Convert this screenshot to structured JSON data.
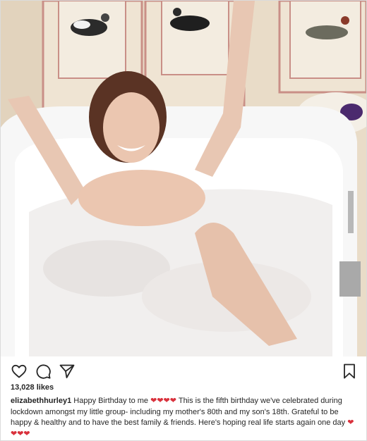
{
  "post": {
    "image": {
      "alt_name": "bathtub-photo"
    },
    "actions": {
      "like_icon": "heart-outline-icon",
      "comment_icon": "comment-icon",
      "share_icon": "send-icon",
      "save_icon": "bookmark-icon"
    },
    "likes": "13,028 likes",
    "caption": {
      "username": "elizabethhurley1",
      "text_1": "Happy Birthday to me",
      "hearts_1": "❤❤❤❤",
      "text_2": "This is the fifth birthday we've celebrated during lockdown amongst my little group- including my mother's 80th and my son's 18th. Grateful to be happy & healthy and to have the best family & friends. Here's hoping real life starts again one day",
      "hearts_2": "❤❤❤❤"
    }
  },
  "colors": {
    "heart_emoji": "#d9313c",
    "text": "#262626",
    "border": "#dbdbdb"
  }
}
